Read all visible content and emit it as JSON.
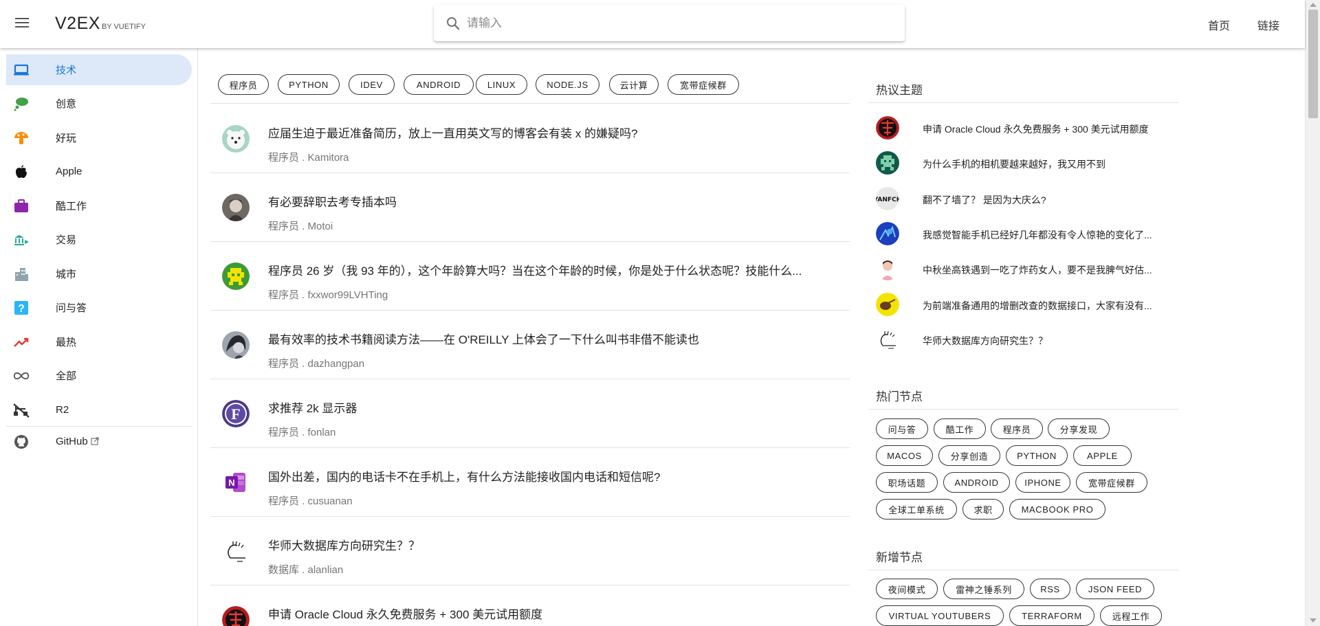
{
  "header": {
    "brand": "V2EX",
    "brand_suffix": "BY VUETIFY",
    "search_placeholder": "请输入",
    "nav": [
      "首页",
      "链接"
    ]
  },
  "sidebar": {
    "items": [
      {
        "label": "技术",
        "icon": "laptop-icon",
        "active": true
      },
      {
        "label": "创意",
        "icon": "thought-bubble-icon",
        "active": false
      },
      {
        "label": "好玩",
        "icon": "mushroom-icon",
        "active": false
      },
      {
        "label": "Apple",
        "icon": "apple-icon",
        "active": false
      },
      {
        "label": "酷工作",
        "icon": "briefcase-icon",
        "active": false
      },
      {
        "label": "交易",
        "icon": "bank-transfer-icon",
        "active": false
      },
      {
        "label": "城市",
        "icon": "city-icon",
        "active": false
      },
      {
        "label": "问与答",
        "icon": "help-box-icon",
        "active": false
      },
      {
        "label": "最热",
        "icon": "trending-up-icon",
        "active": false
      },
      {
        "label": "全部",
        "icon": "infinity-icon",
        "active": false
      },
      {
        "label": "R2",
        "icon": "lan-disconnect-icon",
        "active": false
      },
      {
        "label": "GitHub",
        "icon": "github-icon",
        "active": false
      }
    ],
    "github_external_icon": "open-in-new-icon"
  },
  "main": {
    "tabs": [
      "程序员",
      "PYTHON",
      "IDEV",
      "ANDROID",
      "LINUX",
      "NODE.JS",
      "云计算",
      "宽带症候群"
    ],
    "topics": [
      {
        "title": "应届生迫于最近准备简历，放上一直用英文写的博客会有装 x 的嫌疑吗?",
        "node": "程序员",
        "author": "Kamitora",
        "meta": "程序员 . Kamitora"
      },
      {
        "title": "有必要辞职去考专插本吗",
        "node": "程序员",
        "author": "Motoi",
        "meta": "程序员 . Motoi"
      },
      {
        "title": "程序员 26 岁（我 93 年的），这个年龄算大吗？当在这个年龄的时候，你是处于什么状态呢？技能什么...",
        "node": "程序员",
        "author": "fxxwor99LVHTing",
        "meta": "程序员 . fxxwor99LVHTing"
      },
      {
        "title": "最有效率的技术书籍阅读方法——在 O'REILLY 上体会了一下什么叫书非借不能读也",
        "node": "程序员",
        "author": "dazhangpan",
        "meta": "程序员 . dazhangpan"
      },
      {
        "title": "求推荐 2k 显示器",
        "node": "程序员",
        "author": "fonlan",
        "meta": "程序员 . fonlan"
      },
      {
        "title": "国外出差，国内的电话卡不在手机上，有什么方法能接收国内电话和短信呢?",
        "node": "程序员",
        "author": "cusuanan",
        "meta": "程序员 . cusuanan"
      },
      {
        "title": "华师大数据库方向研究生？？",
        "node": "数据库",
        "author": "alanlian",
        "meta": "数据库 . alanlian"
      },
      {
        "title": "申请 Oracle Cloud 永久免费服务 + 300 美元试用额度",
        "node": "",
        "author": "",
        "meta": ""
      }
    ]
  },
  "right": {
    "hot_title": "热议主题",
    "hot_topics": [
      "申请 Oracle Cloud 永久免费服务 + 300 美元试用额度",
      "为什么手机的相机要越来越好，我又用不到",
      "翻不了墙了？ 是因为大庆么?",
      "我感觉智能手机已经好几年都没有令人惊艳的变化了...",
      "中秋坐高铁遇到一吃了炸药女人，要不是我脾气好估...",
      "为前端准备通用的增删改查的数据接口，大家有没有...",
      "华师大数据库方向研究生？？"
    ],
    "hot_nodes_title": "热门节点",
    "hot_nodes": [
      "问与答",
      "酷工作",
      "程序员",
      "分享发现",
      "MACOS",
      "分享创造",
      "PYTHON",
      "APPLE",
      "职场话题",
      "ANDROID",
      "IPHONE",
      "宽带症候群",
      "全球工单系统",
      "求职",
      "MACBOOK PRO"
    ],
    "new_nodes_title": "新增节点",
    "new_nodes": [
      "夜间模式",
      "雷神之锤系列",
      "RSS",
      "JSON FEED",
      "VIRTUAL YOUTUBERS",
      "TERRAFORM",
      "远程工作"
    ]
  },
  "colors": {
    "accent": "#1976d2",
    "active_bg": "#dde9f8"
  }
}
